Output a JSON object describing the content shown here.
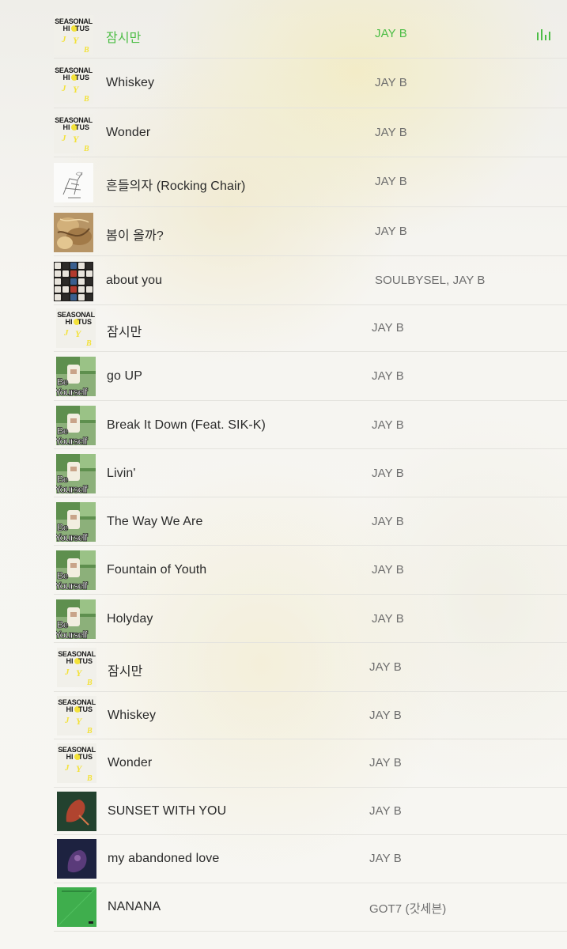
{
  "playlist": [
    [
      {
        "title": "잠시만",
        "artist": "JAY B",
        "art": "seasonal-hiatus",
        "playing": true
      },
      {
        "title": "Whiskey",
        "artist": "JAY B",
        "art": "seasonal-hiatus"
      },
      {
        "title": "Wonder",
        "artist": "JAY B",
        "art": "seasonal-hiatus"
      },
      {
        "title": "흔들의자 (Rocking Chair)",
        "artist": "JAY B",
        "art": "sketch"
      },
      {
        "title": "봄이 올까?",
        "artist": "JAY B",
        "art": "gold"
      },
      {
        "title": "about you",
        "artist": "SOULBYSEL, JAY B",
        "art": "keys"
      }
    ],
    [
      {
        "title": "잠시만",
        "artist": "JAY B",
        "art": "seasonal-hiatus"
      },
      {
        "title": "go UP",
        "artist": "JAY B",
        "art": "be-yourself"
      },
      {
        "title": "Break It Down (Feat. SIK-K)",
        "artist": "JAY B",
        "art": "be-yourself"
      },
      {
        "title": "Livin'",
        "artist": "JAY B",
        "art": "be-yourself"
      },
      {
        "title": "The Way We Are",
        "artist": "JAY B",
        "art": "be-yourself"
      },
      {
        "title": "Fountain of Youth",
        "artist": "JAY B",
        "art": "be-yourself"
      },
      {
        "title": "Holyday",
        "artist": "JAY B",
        "art": "be-yourself"
      }
    ],
    [
      {
        "title": "잠시만",
        "artist": "JAY B",
        "art": "seasonal-hiatus"
      },
      {
        "title": "Whiskey",
        "artist": "JAY B",
        "art": "seasonal-hiatus"
      },
      {
        "title": "Wonder",
        "artist": "JAY B",
        "art": "seasonal-hiatus"
      },
      {
        "title": "SUNSET WITH YOU",
        "artist": "JAY B",
        "art": "sunset"
      },
      {
        "title": "my abandoned love",
        "artist": "JAY B",
        "art": "abandoned"
      },
      {
        "title": "NANANA",
        "artist": "GOT7 (갓세븐)",
        "art": "nanana"
      }
    ]
  ],
  "art_text": {
    "seasonal_line1": "SEASONAL",
    "seasonal_line2": "HI",
    "seasonal_line3": "TUS",
    "seasonal_j": "J",
    "seasonal_y": "Y",
    "seasonal_b": "B",
    "be_yourself": "Be Yourself"
  },
  "colors": {
    "accent": "#4cbd45",
    "seasonal_yellow": "#f3e23a",
    "nanana_green": "#3fae4d"
  },
  "icons": {
    "now_playing": "equalizer-icon"
  }
}
